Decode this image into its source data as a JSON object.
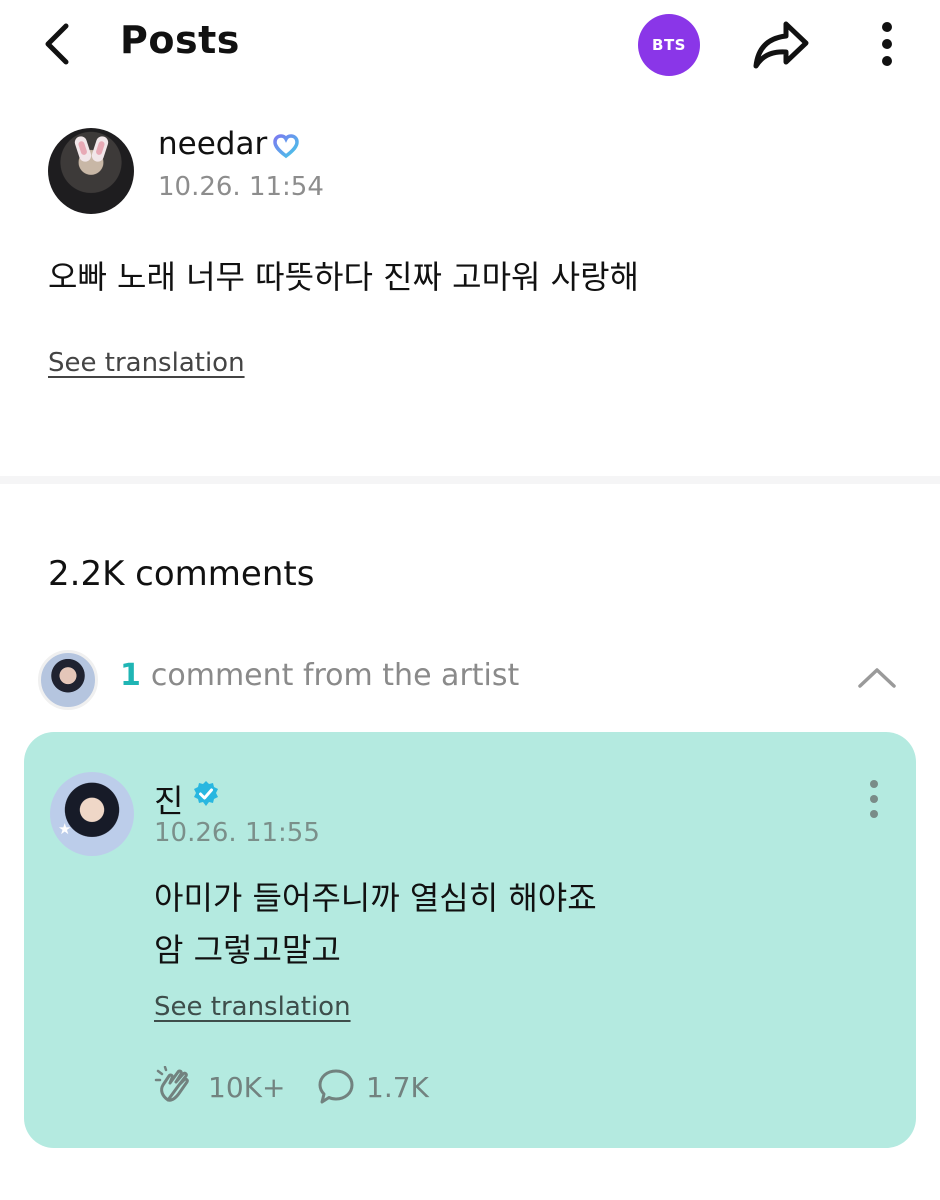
{
  "header": {
    "title": "Posts",
    "community_badge": "BTS",
    "colors": {
      "badge": "#8a36e8"
    },
    "icons": [
      "back-arrow-icon",
      "share-icon",
      "more-vertical-icon"
    ]
  },
  "post": {
    "author": "needar",
    "author_badge_icon": "heart-badge-icon",
    "timestamp": "10.26. 11:54",
    "body": "오빠 노래 너무 따뜻하다 진짜 고마워 사랑해",
    "see_translation": "See translation"
  },
  "comments": {
    "count_label": "2.2K comments",
    "artist_section": {
      "count": "1",
      "label": "comment from the artist",
      "icon": "chevron-up-icon"
    },
    "artist_comment": {
      "name": "진",
      "verified_icon": "verified-badge-icon",
      "timestamp": "10.26. 11:55",
      "lines": [
        "아미가 들어주니까 열심히 해야죠",
        "암 그렇고말고"
      ],
      "see_translation": "See translation",
      "likes": "10K+",
      "replies": "1.7K",
      "colors": {
        "card_background": "#b4eae0",
        "accent": "#1fb5b4"
      }
    }
  }
}
